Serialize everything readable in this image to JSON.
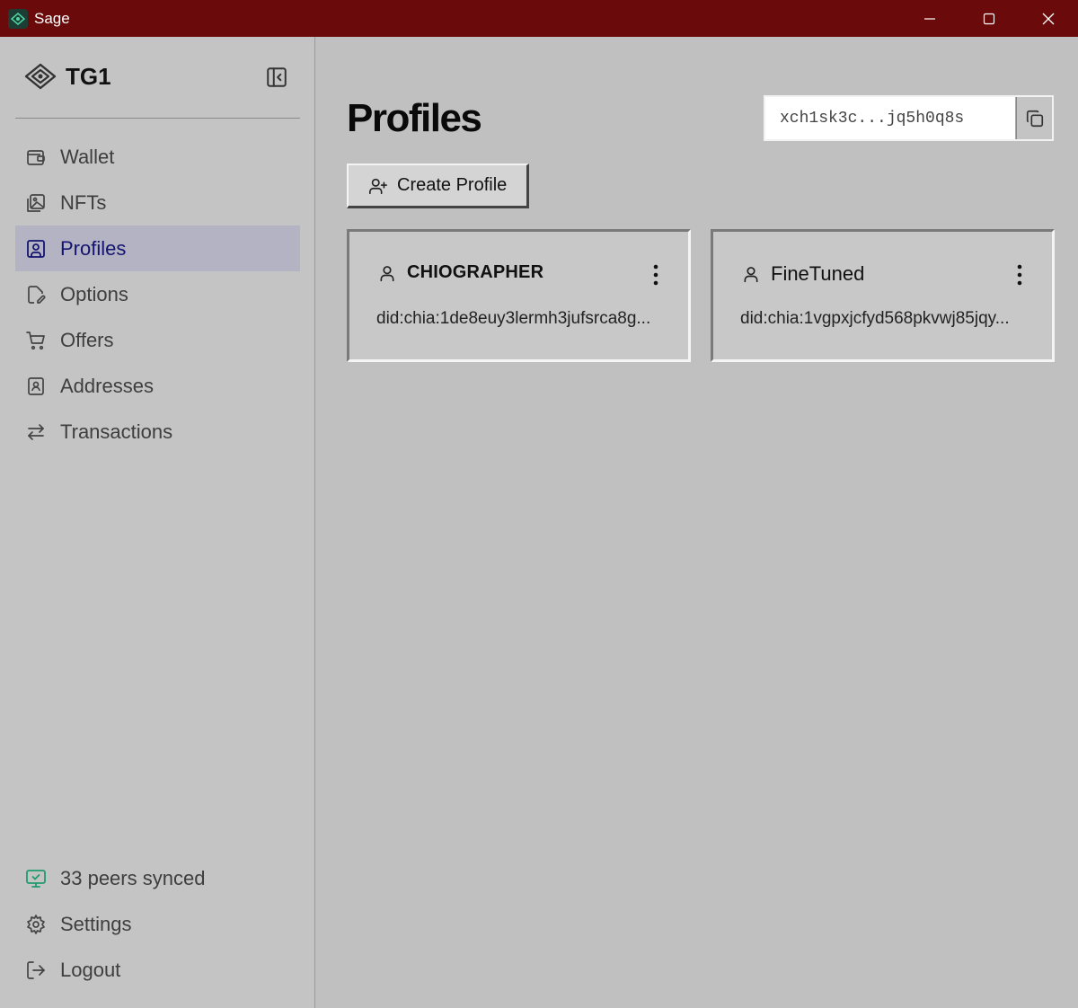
{
  "window": {
    "title": "Sage",
    "icon": "sage-app-icon",
    "controls": [
      "minimize-icon",
      "maximize-icon",
      "close-icon"
    ]
  },
  "sidebar": {
    "wallet_name": "TG1",
    "items": [
      {
        "label": "Wallet",
        "icon": "wallet-icon",
        "active": false
      },
      {
        "label": "NFTs",
        "icon": "images-icon",
        "active": false
      },
      {
        "label": "Profiles",
        "icon": "user-square-icon",
        "active": true
      },
      {
        "label": "Options",
        "icon": "file-pen-icon",
        "active": false
      },
      {
        "label": "Offers",
        "icon": "cart-icon",
        "active": false
      },
      {
        "label": "Addresses",
        "icon": "contact-book-icon",
        "active": false
      },
      {
        "label": "Transactions",
        "icon": "arrows-swap-icon",
        "active": false
      }
    ],
    "bottom": [
      {
        "label": "33 peers synced",
        "icon": "monitor-check-icon"
      },
      {
        "label": "Settings",
        "icon": "gear-icon"
      },
      {
        "label": "Logout",
        "icon": "logout-icon"
      }
    ]
  },
  "main": {
    "title": "Profiles",
    "address": "xch1sk3c...jq5h0q8s",
    "create_button": "Create Profile",
    "profiles": [
      {
        "name": "CHIOGRAPHER",
        "did": "did:chia:1de8euy3lermh3jufsrca8g..."
      },
      {
        "name": "FineTuned",
        "did": "did:chia:1vgpxjcfyd568pkvwj85jqy..."
      }
    ]
  },
  "colors": {
    "titlebar": "#6b0a0a",
    "background": "#c0c0c0",
    "active_nav_bg": "#b3b3c3",
    "active_nav_text": "#141470",
    "synced_icon": "#1e9b6e"
  }
}
